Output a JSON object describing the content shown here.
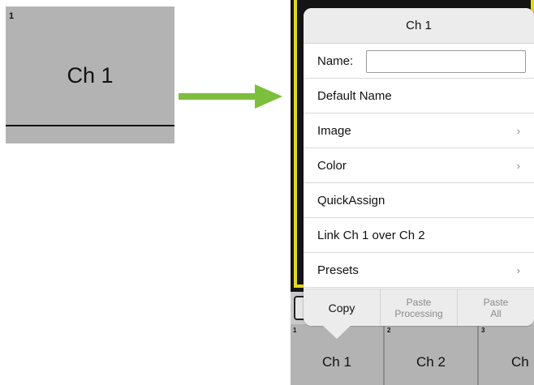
{
  "left_tile": {
    "number": "1",
    "name": "Ch 1"
  },
  "arrow": {
    "color": "#7cbf3c"
  },
  "popup": {
    "title": "Ch 1",
    "name_label": "Name:",
    "name_value": "",
    "items": [
      {
        "label": "Default Name",
        "chevron": ""
      },
      {
        "label": "Image",
        "chevron": "›"
      },
      {
        "label": "Color",
        "chevron": "›"
      },
      {
        "label": "QuickAssign",
        "chevron": ""
      },
      {
        "label": "Link Ch 1 over Ch 2",
        "chevron": ""
      },
      {
        "label": "Presets",
        "chevron": "›"
      }
    ],
    "actions": [
      {
        "label_line1": "Copy",
        "label_line2": ""
      },
      {
        "label_line1": "Paste",
        "label_line2": "Processing"
      },
      {
        "label_line1": "Paste",
        "label_line2": "All"
      }
    ]
  },
  "strips": [
    {
      "number": "1",
      "name": "Ch 1"
    },
    {
      "number": "2",
      "name": "Ch 2"
    },
    {
      "number": "3",
      "name": "Ch"
    }
  ],
  "colors": {
    "tile_gray": "#b3b3b3",
    "highlight_yellow": "#e3d81e",
    "popup_header": "#ececec"
  }
}
